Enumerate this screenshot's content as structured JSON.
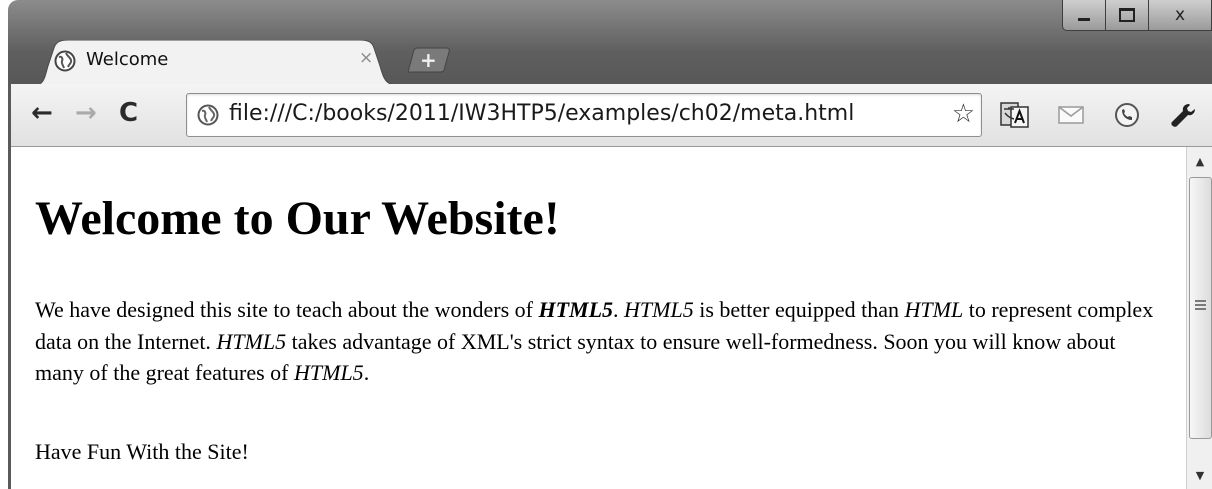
{
  "window": {
    "controls": {
      "minimize": "",
      "maximize": "",
      "close": "x"
    }
  },
  "tabs": [
    {
      "title": "Welcome",
      "close_label": "×",
      "icon": "globe-icon",
      "active": true
    }
  ],
  "new_tab": {
    "label": "+"
  },
  "toolbar": {
    "back_icon": "back-arrow-icon",
    "back_glyph": "←",
    "forward_icon": "forward-arrow-icon",
    "forward_glyph": "→",
    "reload_icon": "reload-icon",
    "reload_glyph": "C",
    "bookmark_glyph": "☆",
    "extensions": [
      "translate-icon",
      "mail-icon",
      "phone-icon",
      "wrench-icon"
    ]
  },
  "address_bar": {
    "url": "file:///C:/books/2011/IW3HTP5/examples/ch02/meta.html",
    "icon": "globe-icon"
  },
  "page": {
    "heading": "Welcome to Our Website!",
    "paragraph": {
      "t1": "We have designed this site to teach about the wonders of ",
      "e1": "HTML5",
      "t2": ". ",
      "e2": "HTML5",
      "t3": " is better equipped than ",
      "e3": "HTML",
      "t4": " to represent complex data on the Internet. ",
      "e4": "HTML5",
      "t5": " takes advantage of XML's strict syntax to ensure well-formedness. Soon you will know about many of the great features of ",
      "e5": "HTML5",
      "t6": "."
    },
    "closing": "Have Fun With the Site!"
  },
  "scrollbar": {
    "up_glyph": "▲",
    "down_glyph": "▼"
  },
  "colors": {
    "chrome_dark": "#5f5f5f",
    "toolbar": "#e8e8e8",
    "page_bg": "#ffffff",
    "text": "#000000"
  }
}
